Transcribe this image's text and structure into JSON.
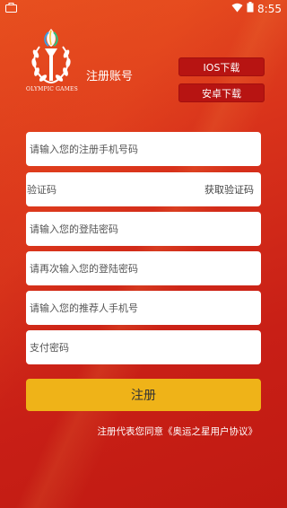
{
  "status_bar": {
    "time": "8:55",
    "left_icon": "briefcase-icon",
    "wifi_icon": "wifi-icon",
    "battery_icon": "battery-icon"
  },
  "brand": {
    "logo_icon": "olympic-torch-laurel-logo",
    "logo_caption": "OLYMPIC GAMES",
    "page_title": "注册账号"
  },
  "downloads": {
    "ios_label": "IOS下载",
    "android_label": "安卓下载"
  },
  "form": {
    "phone_placeholder": "请输入您的注册手机号码",
    "code_placeholder": "验证码",
    "get_code_label": "获取验证码",
    "password_placeholder": "请输入您的登陆密码",
    "password_confirm_placeholder": "请再次输入您的登陆密码",
    "referrer_placeholder": "请输入您的推荐人手机号",
    "pay_password_placeholder": "支付密码",
    "submit_label": "注册"
  },
  "agreement": {
    "prefix": "注册代表您同意",
    "link": "《奥运之星用户协议》"
  },
  "colors": {
    "background": "#d9331b",
    "download_button": "#b71412",
    "submit_button": "#efb318"
  }
}
